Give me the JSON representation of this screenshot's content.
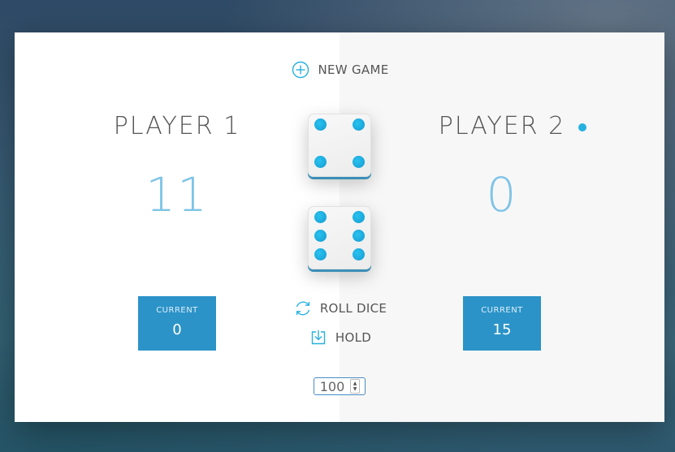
{
  "buttons": {
    "new_game": "NEW GAME",
    "roll_dice": "ROLL DICE",
    "hold": "HOLD"
  },
  "players": [
    {
      "name": "PLAYER 1",
      "score": "11",
      "current_label": "CURRENT",
      "current_score": "0",
      "active": false
    },
    {
      "name": "PLAYER 2",
      "score": "0",
      "current_label": "CURRENT",
      "current_score": "15",
      "active": true
    }
  ],
  "dice": [
    {
      "value": 4
    },
    {
      "value": 6
    }
  ],
  "winning_score": {
    "value": "100"
  },
  "colors": {
    "accent": "#27b1e0",
    "current_box": "#2b93c8",
    "score_text": "#7fc4e6",
    "pip": "#1aa6da"
  },
  "icons": {
    "new_game": "plus-circle-icon",
    "roll_dice": "refresh-icon",
    "hold": "download-icon"
  }
}
